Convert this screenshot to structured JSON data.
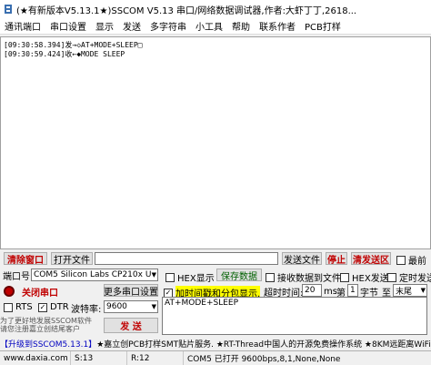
{
  "window": {
    "title": "(★有新版本V5.13.1★)SSCOM V5.13 串口/网络数据调试器,作者:大虾丁丁,2618..."
  },
  "menu": [
    "通讯端口",
    "串口设置",
    "显示",
    "发送",
    "多字符串",
    "小工具",
    "帮助",
    "联系作者",
    "PCB打样"
  ],
  "output": {
    "lines": [
      "[09:30:58.394]发→◇AT+MODE+SLEEP□",
      "[09:30:59.424]收←◆MODE SLEEP"
    ]
  },
  "toolbar_row": {
    "clear_window": "清除窗口",
    "open_file": "打开文件",
    "send_file": "发送文件",
    "stop": "停止",
    "clear_send_area": "清发送区",
    "last": "最前"
  },
  "port": {
    "label": "端口号",
    "value": "COM5 Silicon Labs CP210x U",
    "hex_display": "HEX显示",
    "save_data": "保存数据",
    "recv_to_file": "接收数据到文件",
    "hex_send": "HEX发送",
    "timed_send": "定时发送",
    "close_port": "关闭串口",
    "more_settings": "更多串口设置",
    "timestamp": "加时间戳和分包显示.",
    "timeout_label": "超时时间:",
    "timeout_value": "20",
    "ms_label": "ms",
    "nth_label": "第",
    "nth_value": "1",
    "byte_label": "字节",
    "to_label": "至",
    "tail_value": "末尾",
    "rts": "RTS",
    "dtr": "DTR",
    "baud_label": "波特率:",
    "baud_value": "9600",
    "send_text": "AT+MODE+SLEEP",
    "send_button": "发 送",
    "promo_text": "为了更好地发展SSCOM软件\n请您注册嘉立创结尾客户"
  },
  "ticker": {
    "link": "【升级到SSCOM5.13.1】",
    "text": "★嘉立创PCB打样SMT贴片服务. ★RT-Thread中国人的开源免费操作系统 ★8KM远距离WiFi"
  },
  "status": {
    "site": "www.daxia.com",
    "s": "S:13",
    "r": "R:12",
    "port_status": "COM5 已打开  9600bps,8,1,None,None"
  }
}
